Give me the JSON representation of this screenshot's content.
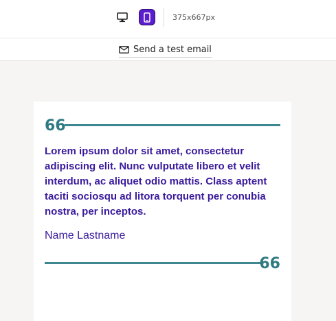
{
  "toolbar": {
    "viewport_size": "375x667px",
    "accent_color": "#5b1ecf",
    "desktop_icon": "monitor-icon",
    "mobile_icon": "phone-icon"
  },
  "email_bar": {
    "label": "Send a test email",
    "icon": "envelope-icon"
  },
  "quote_block": {
    "text": "Lorem ipsum dolor sit amet, consectetur adipiscing elit. Nunc vulputate libero et velit interdum, ac aliquet odio mattis. Class aptent taciti sociosqu ad litora torquent per conubia nostra, per inceptos.",
    "author": "Name Lastname",
    "open_mark": "66",
    "close_mark": "66",
    "text_color": "#3a1a9c",
    "rule_color": "#3d8890"
  }
}
